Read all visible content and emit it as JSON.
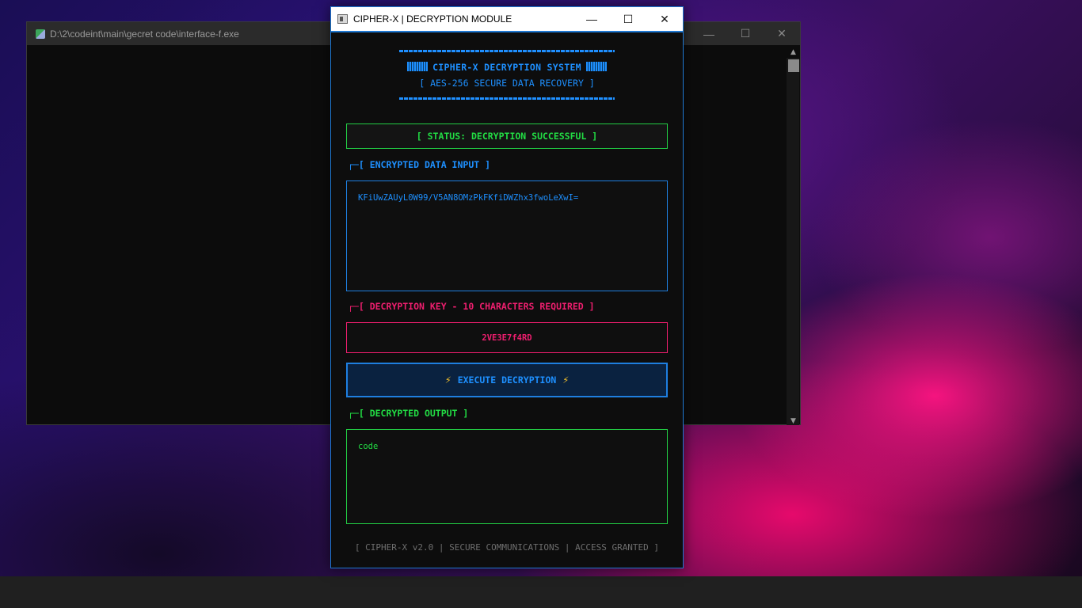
{
  "console_window": {
    "title": "D:\\2\\codeint\\main\\gecret code\\interface-f.exe",
    "minimize_glyph": "—",
    "maximize_glyph": "☐",
    "close_glyph": "✕"
  },
  "cipher_window": {
    "title": "CIPHER-X | DECRYPTION MODULE",
    "minimize_glyph": "—",
    "maximize_glyph": "☐",
    "close_glyph": "✕"
  },
  "banner": {
    "title": "CIPHER-X DECRYPTION SYSTEM",
    "subtitle": "[ AES-256 SECURE DATA RECOVERY ]"
  },
  "status": {
    "text": "[ STATUS: DECRYPTION SUCCESSFUL ]"
  },
  "encrypted_input": {
    "label_corner": "┌─",
    "label": "[ ENCRYPTED DATA INPUT ]",
    "value": "KFiUwZAUyL0W99/V5AN8OMzPkFKfiDWZhx3fwoLeXwI="
  },
  "decryption_key": {
    "label_corner": "┌─",
    "label": "[ DECRYPTION KEY - 10 CHARACTERS REQUIRED ]",
    "value": "2VE3E7f4RD"
  },
  "execute_button": {
    "label": "EXECUTE DECRYPTION",
    "bolt": "⚡"
  },
  "decrypted_output": {
    "label_corner": "┌─",
    "label": "[ DECRYPTED OUTPUT ]",
    "value": "code"
  },
  "footer": {
    "text": "[ CIPHER-X v2.0 | SECURE COMMUNICATIONS | ACCESS GRANTED ]"
  },
  "colors": {
    "accent_blue": "#1e90ff",
    "key_pink": "#ee1e6e",
    "success_green": "#22dd44",
    "bolt_yellow": "#f6c12b"
  },
  "icons": [
    "console-app-icon",
    "cipher-app-icon",
    "minimize-icon",
    "maximize-icon",
    "close-icon",
    "bolt-icon"
  ]
}
